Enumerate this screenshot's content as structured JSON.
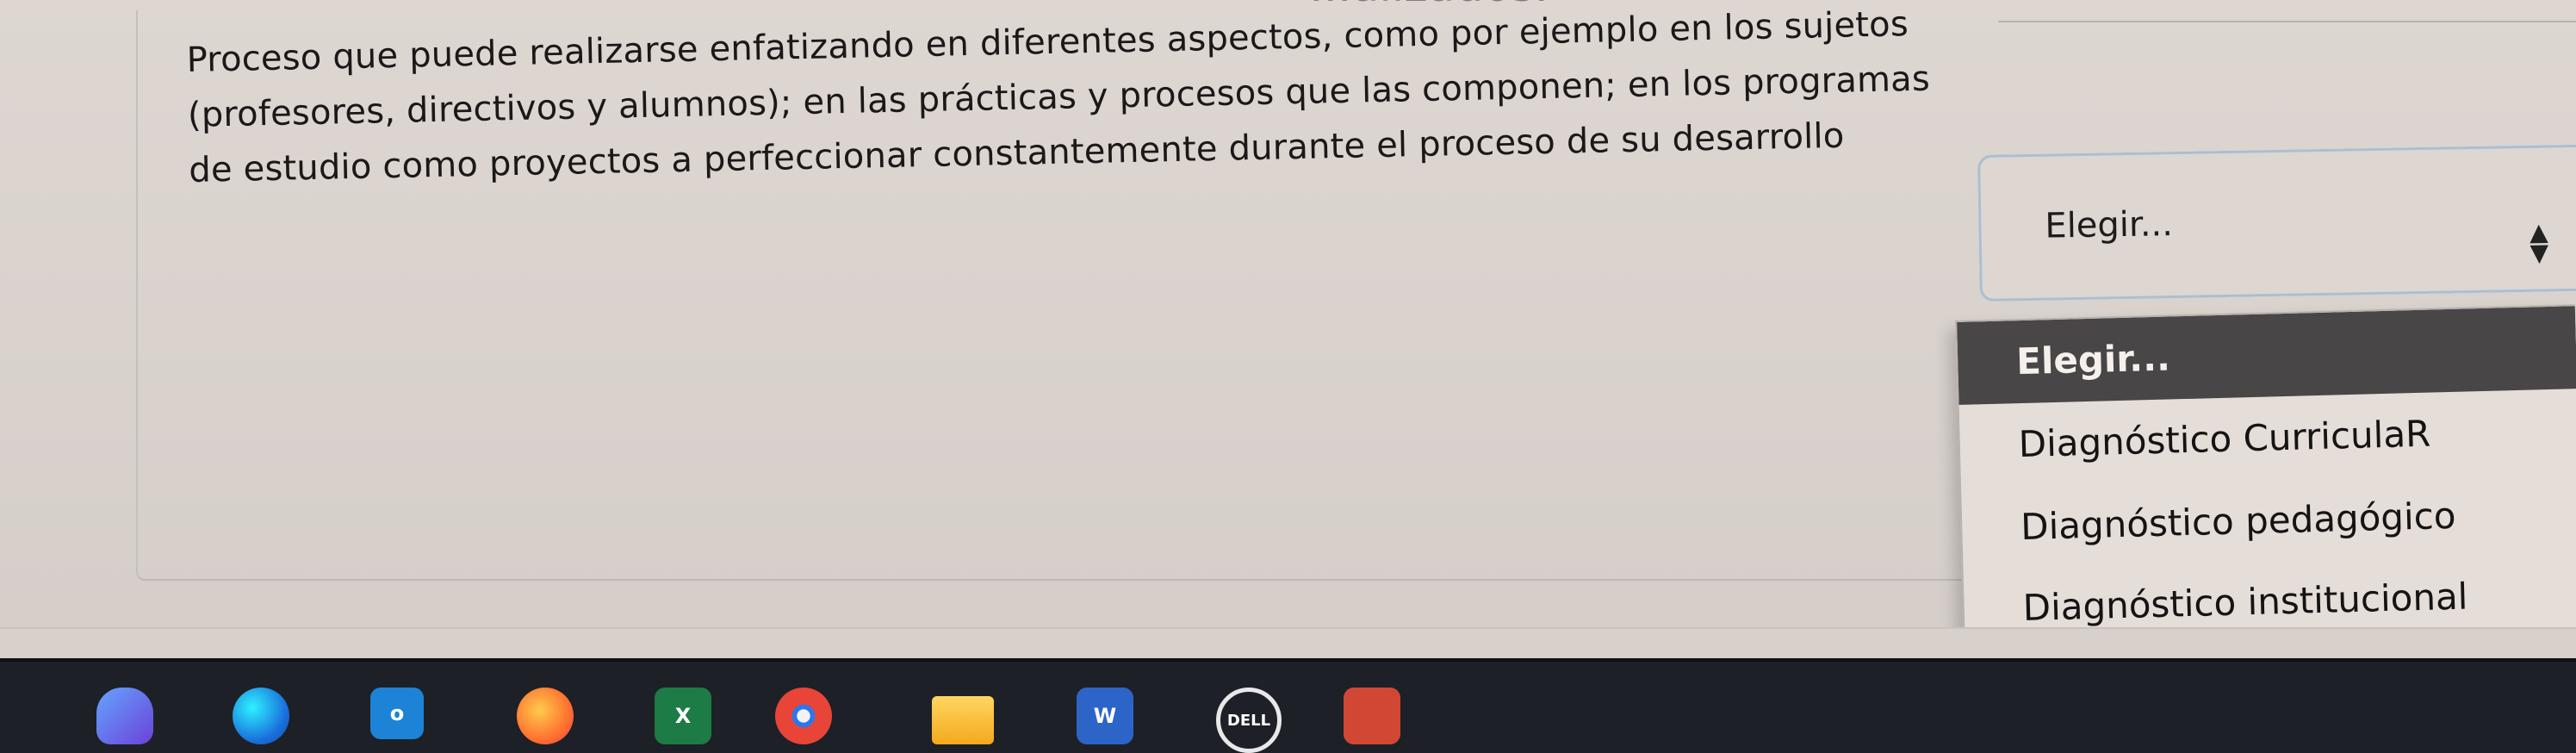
{
  "question": {
    "partial_previous_text": "...alizados.",
    "statement": "Proceso que puede realizarse enfatizando en diferentes aspectos, como por ejemplo en los sujetos (profesores, directivos y alumnos); en las prácticas y procesos que las componen; en los programas de estudio como proyectos a perfeccionar constantemente durante el proceso de su desarrollo"
  },
  "dropdown": {
    "selected_value": "Elegir...",
    "options": [
      "Elegir...",
      "Diagnóstico CurriculaR",
      "Diagnóstico pedagógico",
      "Diagnóstico institucional"
    ],
    "highlighted_index": 0
  },
  "taskbar": {
    "apps": [
      {
        "name": "search",
        "icon": "search-icon",
        "label": ""
      },
      {
        "name": "edge",
        "icon": "edge-icon",
        "label": ""
      },
      {
        "name": "outlook",
        "icon": "outlook-icon",
        "label": "o"
      },
      {
        "name": "firefox",
        "icon": "firefox-icon",
        "label": ""
      },
      {
        "name": "excel",
        "icon": "excel-icon",
        "label": "X"
      },
      {
        "name": "chrome",
        "icon": "chrome-icon",
        "label": ""
      },
      {
        "name": "file-explorer",
        "icon": "folder-icon",
        "label": ""
      },
      {
        "name": "word",
        "icon": "word-icon",
        "label": "W"
      },
      {
        "name": "dell",
        "icon": "dell-icon",
        "label": "DELL"
      },
      {
        "name": "pdf",
        "icon": "pdf-icon",
        "label": ""
      }
    ]
  },
  "colors": {
    "background": "#d9d2cd",
    "selected_option_background": "#484646",
    "selected_option_text": "#f5f0ec",
    "select_border": "#a9bfd4",
    "taskbar": "#1d2026"
  }
}
